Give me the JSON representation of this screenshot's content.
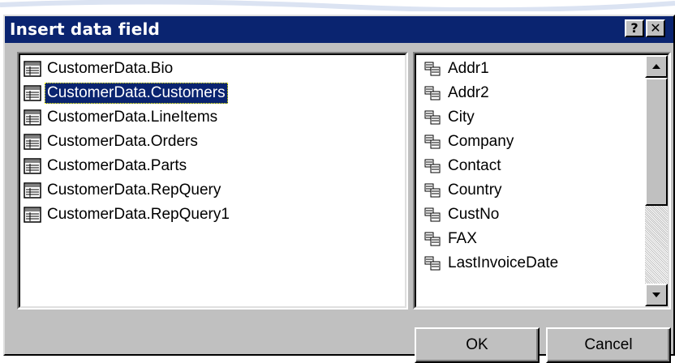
{
  "dialog": {
    "title": "Insert data field",
    "help_label": "?",
    "close_label": "✕"
  },
  "tables": {
    "selected_index": 1,
    "items": [
      {
        "label": "CustomerData.Bio"
      },
      {
        "label": "CustomerData.Customers"
      },
      {
        "label": "CustomerData.LineItems"
      },
      {
        "label": "CustomerData.Orders"
      },
      {
        "label": "CustomerData.Parts"
      },
      {
        "label": "CustomerData.RepQuery"
      },
      {
        "label": "CustomerData.RepQuery1"
      }
    ]
  },
  "fields": {
    "items": [
      {
        "label": "Addr1"
      },
      {
        "label": "Addr2"
      },
      {
        "label": "City"
      },
      {
        "label": "Company"
      },
      {
        "label": "Contact"
      },
      {
        "label": "Country"
      },
      {
        "label": "CustNo"
      },
      {
        "label": "FAX"
      },
      {
        "label": "LastInvoiceDate"
      }
    ]
  },
  "buttons": {
    "ok_label": "OK",
    "cancel_label": "Cancel"
  },
  "icons": {
    "table_icon": "table-icon",
    "field_icon": "field-icon"
  }
}
